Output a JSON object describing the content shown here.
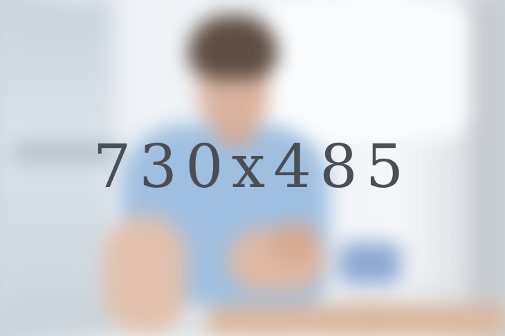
{
  "placeholder": {
    "dimension_label": "730x485",
    "text_color": "#4a4f56"
  },
  "photo": {
    "subject": "blurred-person-at-desk",
    "colors": {
      "shirt": "#9fbfe0",
      "hair": "#5d4d43",
      "skin": "#d9b29d",
      "background": "#edf1f5"
    }
  }
}
